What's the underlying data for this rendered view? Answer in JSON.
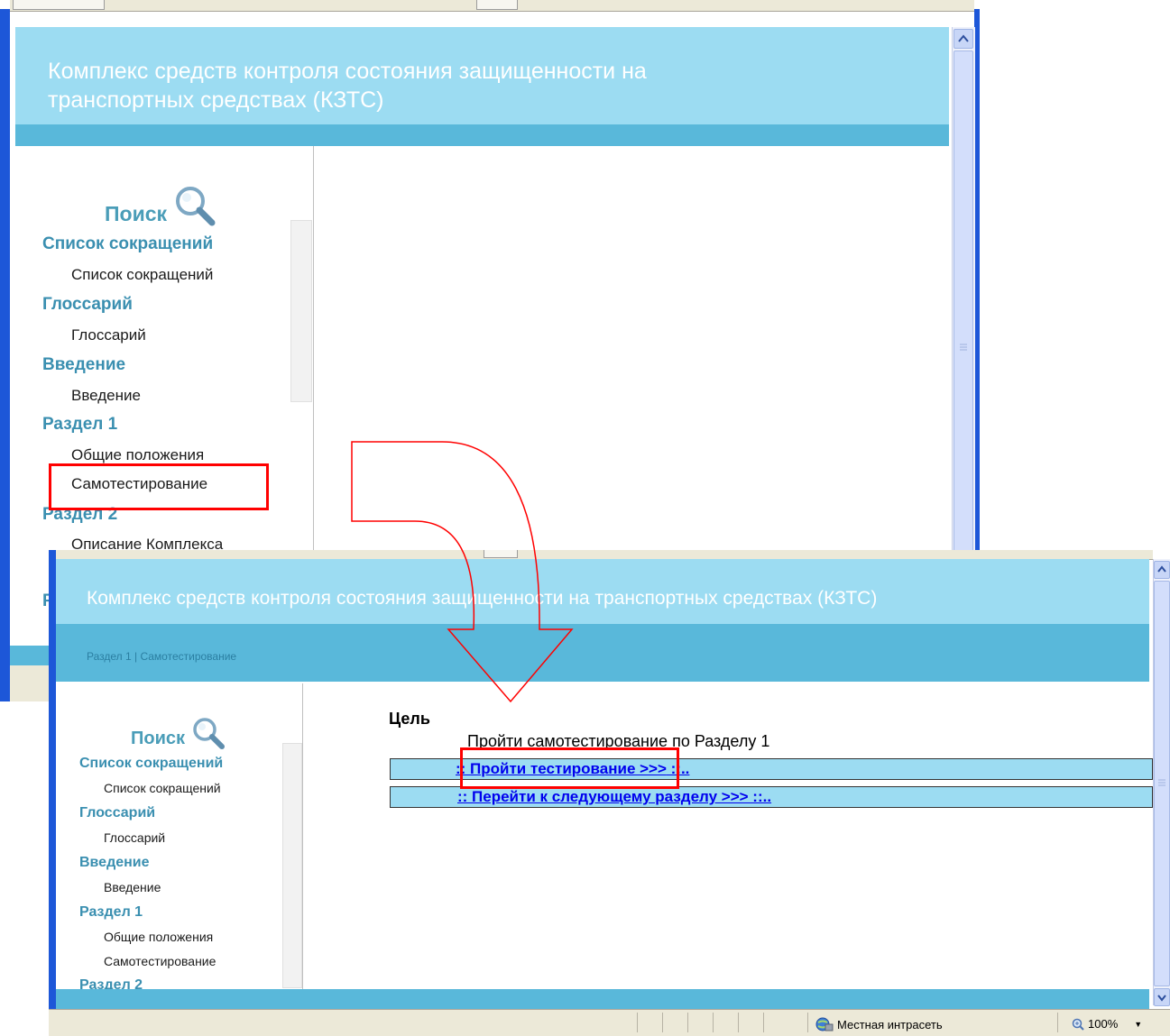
{
  "back_window": {
    "title_line1": "Комплекс средств контроля состояния защищенности на",
    "title_line2": "транспортных средствах (КЗТС)",
    "search_label": "Поиск",
    "nav": [
      {
        "label": "Список сокращений",
        "type": "section"
      },
      {
        "label": "Список сокращений",
        "type": "item"
      },
      {
        "label": "Глоссарий",
        "type": "section"
      },
      {
        "label": "Глоссарий",
        "type": "item"
      },
      {
        "label": "Введение",
        "type": "section"
      },
      {
        "label": "Введение",
        "type": "item"
      },
      {
        "label": "Раздел 1",
        "type": "section"
      },
      {
        "label": "Общие положения",
        "type": "item"
      },
      {
        "label": "Самотестирование",
        "type": "item",
        "highlighted": true
      },
      {
        "label": "Раздел 2",
        "type": "section"
      },
      {
        "label": "Описание Комплекса",
        "type": "item"
      }
    ],
    "partial_letter": "Р"
  },
  "front_window": {
    "title": "Комплекс средств контроля состояния защищенности на транспортных средствах (КЗТС)",
    "breadcrumb": "Раздел 1 | Самотестирование",
    "search_label": "Поиск",
    "nav": [
      {
        "label": "Список сокращений",
        "type": "section"
      },
      {
        "label": "Список сокращений",
        "type": "item"
      },
      {
        "label": "Глоссарий",
        "type": "section"
      },
      {
        "label": "Глоссарий",
        "type": "item"
      },
      {
        "label": "Введение",
        "type": "section"
      },
      {
        "label": "Введение",
        "type": "item"
      },
      {
        "label": "Раздел 1",
        "type": "section"
      },
      {
        "label": "Общие положения",
        "type": "item"
      },
      {
        "label": "Самотестирование",
        "type": "item"
      },
      {
        "label": "Раздел 2",
        "type": "section"
      }
    ],
    "goal_heading": "Цель",
    "goal_text": "Пройти самотестирование по Разделу 1",
    "link_test_prefix": ":: ",
    "link_test": "Пройти тестирование >>>",
    "link_test_suffix": " ::..",
    "link_next": ":: Перейти к следующему разделу >>> ::..",
    "status_zone": "Местная интрасеть",
    "status_zoom": "100%"
  },
  "colors": {
    "header_light": "#9cdcf2",
    "header_band": "#59b8da",
    "section_text": "#3a8fb0",
    "annotation_red": "#ff0000",
    "xp_frame": "#1d57d8"
  },
  "icons": [
    "search-icon",
    "zone-globe-icon",
    "zoom-icon",
    "scroll-up-icon",
    "scroll-down-icon",
    "dropdown-icon"
  ]
}
